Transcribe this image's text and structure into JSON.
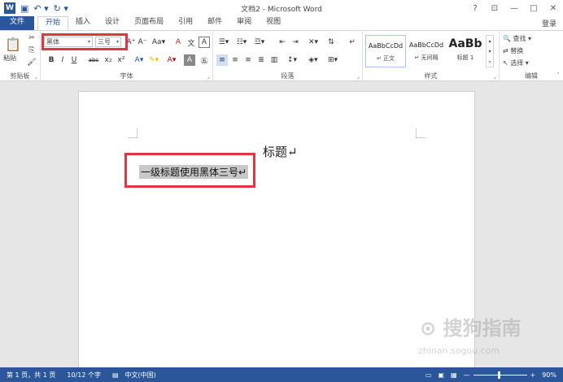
{
  "window": {
    "title": "文档2 - Microsoft Word",
    "help": "?",
    "ribbon_display": "⊡",
    "minimize": "—",
    "restore": "□",
    "close": "✕",
    "sign_in": "登录"
  },
  "tabs": [
    "文件",
    "开始",
    "插入",
    "设计",
    "页面布局",
    "引用",
    "邮件",
    "审阅",
    "视图"
  ],
  "active_tab": "开始",
  "ribbon": {
    "clipboard": {
      "label": "剪贴板",
      "paste": "粘贴"
    },
    "font": {
      "label": "字体",
      "font_name": "黑体",
      "font_size": "三号"
    },
    "paragraph": {
      "label": "段落"
    },
    "styles": {
      "label": "样式",
      "items": [
        {
          "sample": "AaBbCcDd",
          "name": "↵ 正文"
        },
        {
          "sample": "AaBbCcDd",
          "name": "↵ 无间隔"
        },
        {
          "sample": "AaBb",
          "name": "标题 1"
        }
      ]
    },
    "editing": {
      "label": "编辑",
      "find": "查找",
      "replace": "替换",
      "select": "选择"
    }
  },
  "document": {
    "heading": "标题↵",
    "selected_line": "一级标题使用黑体三号↵"
  },
  "status_bar": {
    "page": "第 1 页，共 1 页",
    "words": "10/12 个字",
    "language": "中文(中国)",
    "zoom": "90%"
  },
  "watermark": {
    "brand": "搜狗指南",
    "url": "zhinan.sogou.com"
  },
  "colors": {
    "accent": "#2b579a",
    "highlight": "#e0373f"
  }
}
